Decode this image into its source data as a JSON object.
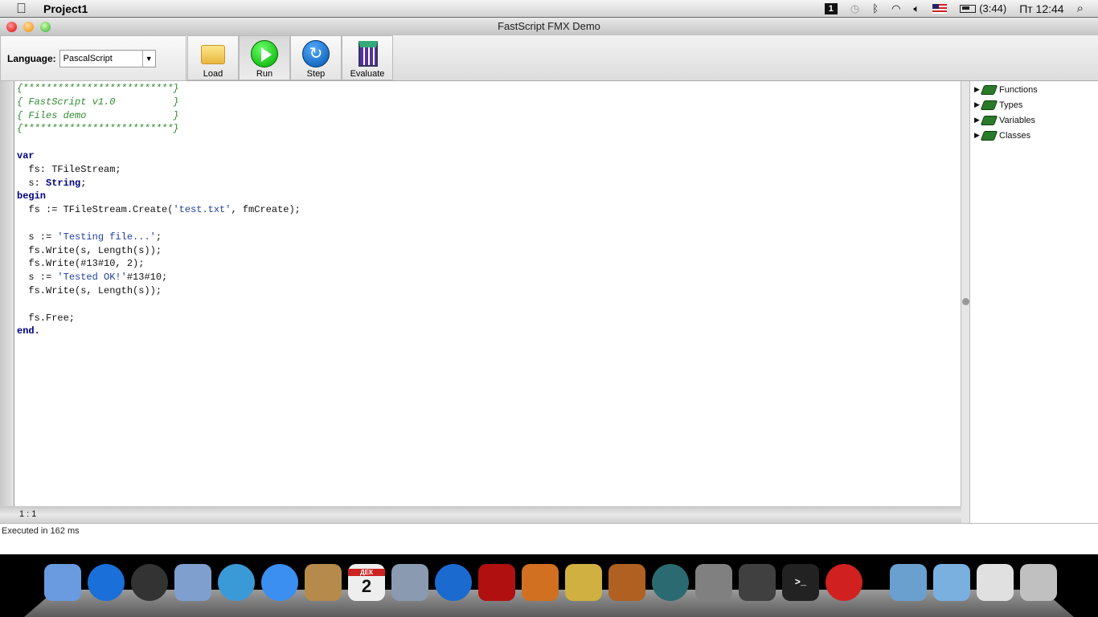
{
  "menubar": {
    "app_name": "Project1",
    "badge": "1",
    "battery": "(3:44)",
    "clock": "Пт 12:44"
  },
  "window": {
    "title": "FastScript FMX Demo"
  },
  "toolbar": {
    "language_label": "Language:",
    "language_value": "PascalScript",
    "buttons": [
      {
        "label": "Load"
      },
      {
        "label": "Run"
      },
      {
        "label": "Step"
      },
      {
        "label": "Evaluate"
      }
    ]
  },
  "editor": {
    "lines": [
      [
        [
          "cm",
          "{**************************}"
        ]
      ],
      [
        [
          "cm",
          "{ FastScript v1.0          }"
        ]
      ],
      [
        [
          "cm",
          "{ Files demo               }"
        ]
      ],
      [
        [
          "cm",
          "{**************************}"
        ]
      ],
      [],
      [
        [
          "kw",
          "var"
        ]
      ],
      [
        [
          "",
          "  fs: TFileStream;"
        ]
      ],
      [
        [
          "",
          "  s: "
        ],
        [
          "kw",
          "String"
        ],
        [
          "",
          ";"
        ]
      ],
      [
        [
          "kw",
          "begin"
        ]
      ],
      [
        [
          "",
          "  fs := TFileStream.Create("
        ],
        [
          "str",
          "'test.txt'"
        ],
        [
          "",
          ", fmCreate);"
        ]
      ],
      [],
      [
        [
          "",
          "  s := "
        ],
        [
          "str",
          "'Testing file...'"
        ],
        [
          "",
          ";"
        ]
      ],
      [
        [
          "",
          "  fs.Write(s, Length(s));"
        ]
      ],
      [
        [
          "",
          "  fs.Write(#13#10, 2);"
        ]
      ],
      [
        [
          "",
          "  s := "
        ],
        [
          "str",
          "'Tested OK!'"
        ],
        [
          "",
          "#13#10;"
        ]
      ],
      [
        [
          "",
          "  fs.Write(s, Length(s));"
        ]
      ],
      [],
      [
        [
          "",
          "  fs.Free;"
        ]
      ],
      [
        [
          "kw",
          "end."
        ]
      ]
    ],
    "cursor": "1 : 1"
  },
  "tree": {
    "items": [
      {
        "label": "Functions"
      },
      {
        "label": "Types"
      },
      {
        "label": "Variables"
      },
      {
        "label": "Classes"
      }
    ]
  },
  "log": {
    "text": "Executed in 162 ms"
  },
  "dock": {
    "calendar_month": "ДЕК",
    "calendar_day": "2",
    "items": [
      {
        "name": "finder",
        "color": "#6a9be0"
      },
      {
        "name": "app-store",
        "color": "#1a6fd8"
      },
      {
        "name": "dashboard",
        "color": "#333333"
      },
      {
        "name": "mail",
        "color": "#7f9fcf"
      },
      {
        "name": "safari",
        "color": "#3a9ad8"
      },
      {
        "name": "facetime",
        "color": "#3a8ff0"
      },
      {
        "name": "address-book",
        "color": "#b58a4a"
      },
      {
        "name": "ical",
        "color": "#eeeeee"
      },
      {
        "name": "iphoto",
        "color": "#8a9ab0"
      },
      {
        "name": "itunes",
        "color": "#1a6ad0"
      },
      {
        "name": "photo-booth",
        "color": "#b01010"
      },
      {
        "name": "image-capture",
        "color": "#d07020"
      },
      {
        "name": "imovie",
        "color": "#d0b040"
      },
      {
        "name": "garageband",
        "color": "#b06020"
      },
      {
        "name": "time-machine",
        "color": "#2a6a70"
      },
      {
        "name": "system-preferences",
        "color": "#808080"
      },
      {
        "name": "quicktime",
        "color": "#404040"
      },
      {
        "name": "terminal",
        "color": "#222222"
      },
      {
        "name": "fmx-app",
        "color": "#d02020"
      },
      {
        "name": "applications-folder",
        "color": "#6aa0d0"
      },
      {
        "name": "documents-folder",
        "color": "#7ab0e0"
      },
      {
        "name": "doc-file",
        "color": "#e0e0e0"
      },
      {
        "name": "trash",
        "color": "#c0c0c0"
      }
    ]
  }
}
